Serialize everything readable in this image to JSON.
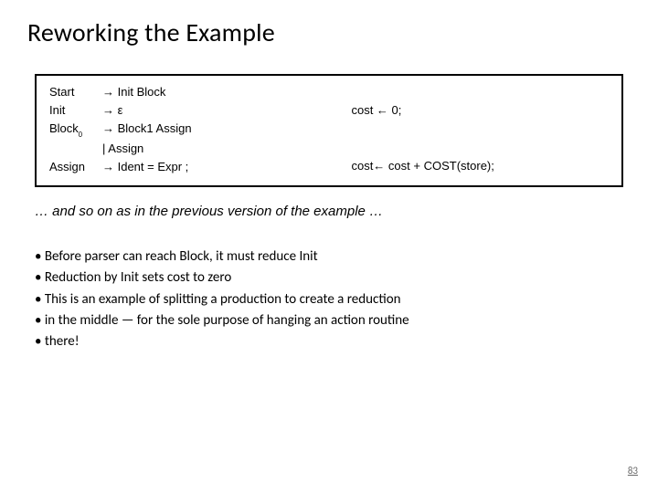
{
  "title": "Reworking the Example",
  "grammar": {
    "r0_lhs": "Start",
    "r0_rhs": "→  Init Block",
    "r1_lhs": "Init",
    "r1_rhs": "→ ε",
    "r1_action": "cost ← 0;",
    "r2_lhs_base": "Block",
    "r2_lhs_sub": "0",
    "r2_rhs": "→ Block1 Assign",
    "r2b_lhs": "",
    "r2b_rhs": " |  Assign",
    "r3_lhs": "Assign",
    "r3_rhs": "→ Ident = Expr ;",
    "r3_action": "cost← cost + COST(store);"
  },
  "aside": "… and so on as in the previous version of the example …",
  "bullets": {
    "b0": "• Before parser can reach Block, it must reduce Init",
    "b1": "• Reduction by Init sets cost to zero",
    "b2": "• This is an example of splitting a production to create a reduction",
    "b3": "• in the middle — for the sole purpose of hanging an action routine",
    "b4": "• there!"
  },
  "page": "83"
}
